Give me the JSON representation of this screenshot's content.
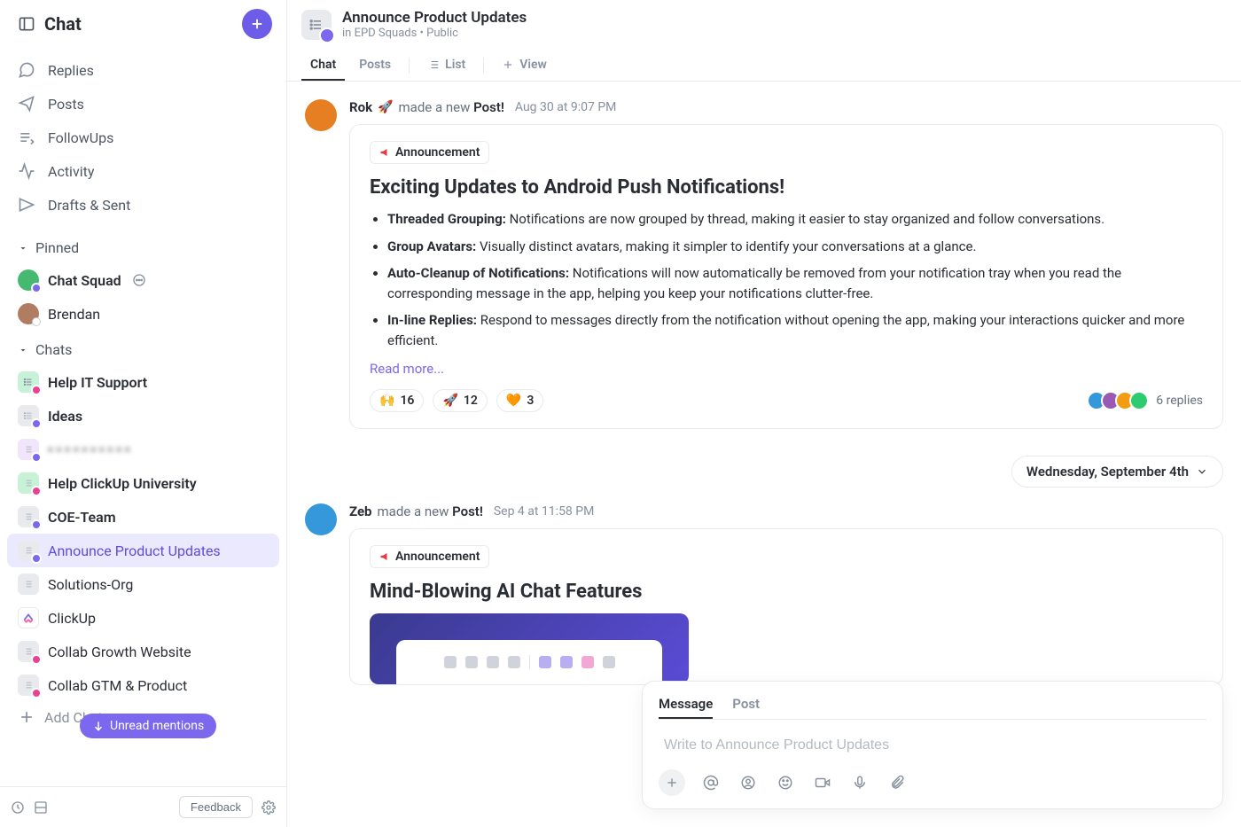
{
  "sidebar": {
    "title": "Chat",
    "nav": {
      "replies": "Replies",
      "posts": "Posts",
      "followups": "FollowUps",
      "activity": "Activity",
      "drafts": "Drafts & Sent"
    },
    "pinned_header": "Pinned",
    "chats_header": "Chats",
    "pinned": {
      "chat_squad": "Chat Squad",
      "brendan": "Brendan"
    },
    "chats": {
      "help_it": "Help IT Support",
      "ideas": "Ideas",
      "blurred": "• • • • • • • • • •",
      "help_clickup": "Help ClickUp University",
      "coe": "COE-Team",
      "announce": "Announce Product Updates",
      "solutions": "Solutions-Org",
      "clickup": "ClickUp",
      "collab_growth": "Collab Growth Website",
      "collab_gtm": "Collab GTM & Product",
      "add_chat": "Add Chat"
    },
    "unread_pill": "Unread mentions",
    "feedback": "Feedback"
  },
  "header": {
    "title": "Announce Product Updates",
    "sub_prefix": "in ",
    "sub_location": "EPD Squads",
    "sub_sep": " • ",
    "sub_visibility": "Public",
    "tabs": {
      "chat": "Chat",
      "posts": "Posts",
      "list": "List",
      "view": "View"
    }
  },
  "post1": {
    "author": "Rok",
    "emoji": "🚀",
    "action_pre": "made a new ",
    "action_post": "Post!",
    "time": "Aug 30 at 9:07 PM",
    "tag": "Announcement",
    "title": "Exciting Updates to Android Push Notifications!",
    "bullets": [
      {
        "b": "Threaded Grouping:",
        "t": " Notifications are now grouped by thread, making it easier to stay organized and follow conversations."
      },
      {
        "b": "Group Avatars:",
        "t": " Visually distinct avatars, making it simpler to identify your conversations at a glance."
      },
      {
        "b": "Auto-Cleanup of Notifications:",
        "t": " Notifications will now automatically be removed from your notification tray when you read the corresponding message in the app, helping you keep your notifications clutter-free."
      },
      {
        "b": "In-line Replies:",
        "t": " Respond to messages directly from the notification without opening the app, making your interactions quicker and more efficient."
      }
    ],
    "read_more": "Read more...",
    "reactions": {
      "r1_emoji": "🙌",
      "r1_count": "16",
      "r2_emoji": "🚀",
      "r2_count": "12",
      "r3_emoji": "🧡",
      "r3_count": "3"
    },
    "replies": "6 replies"
  },
  "date_sep": "Wednesday, September 4th",
  "post2": {
    "author": "Zeb",
    "action_pre": "made a new ",
    "action_post": "Post!",
    "time": "Sep 4 at 11:58 PM",
    "tag": "Announcement",
    "title": "Mind-Blowing AI Chat Features"
  },
  "composer": {
    "tab_message": "Message",
    "tab_post": "Post",
    "placeholder": "Write to Announce Product Updates"
  }
}
